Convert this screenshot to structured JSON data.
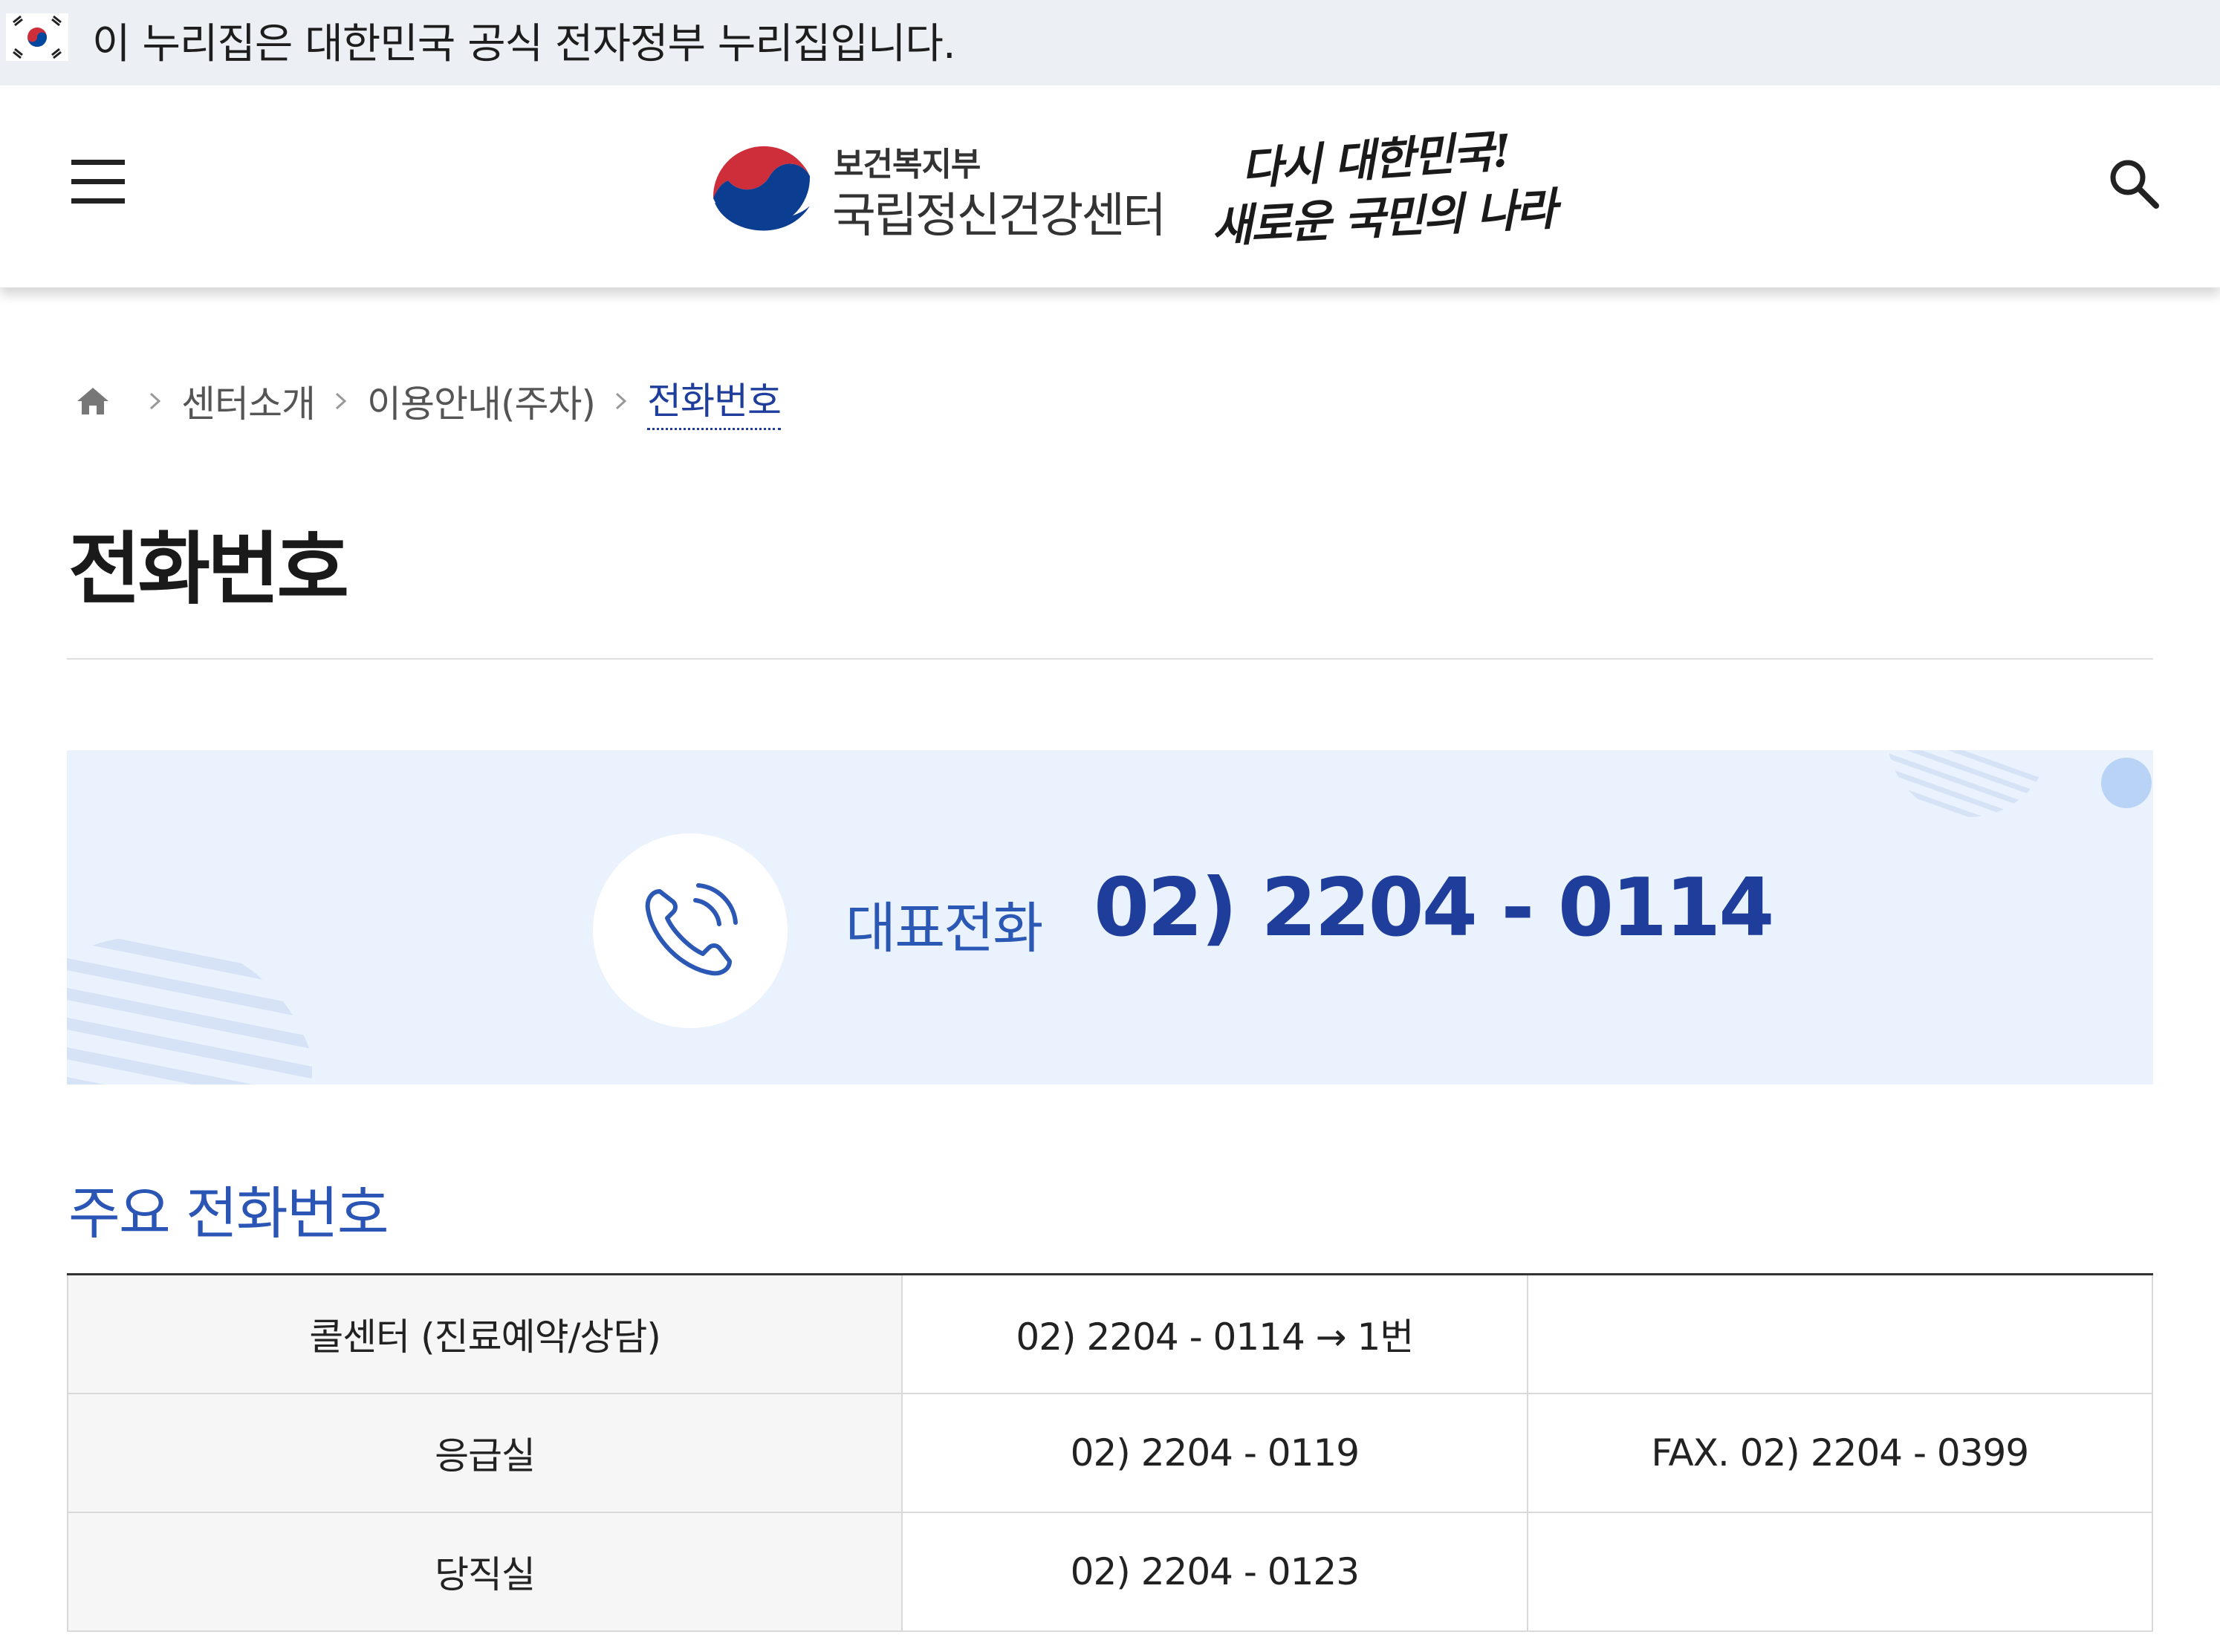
{
  "gov_banner": {
    "text": "이 누리집은 대한민국 공식 전자정부 누리집입니다."
  },
  "header": {
    "ministry": "보건복지부",
    "center_name": "국립정신건강센터",
    "slogan_line1": "다시 대한민국!",
    "slogan_line2": "새로운 국민의 나라"
  },
  "breadcrumb": {
    "items": [
      "센터소개",
      "이용안내(주차)"
    ],
    "current": "전화번호"
  },
  "page_title": "전화번호",
  "main_phone": {
    "label": "대표전화",
    "number": "02) 2204 - 0114"
  },
  "section_title": "주요 전화번호",
  "phone_table": {
    "rows": [
      {
        "name": "콜센터 (진료예약/상담)",
        "phone": "02) 2204 - 0114 → 1번",
        "fax": ""
      },
      {
        "name": "응급실",
        "phone": "02) 2204 - 0119",
        "fax": "FAX. 02) 2204 - 0399"
      },
      {
        "name": "당직실",
        "phone": "02) 2204 - 0123",
        "fax": ""
      }
    ]
  },
  "icons": {
    "menu": "hamburger-menu-icon",
    "search": "search-icon",
    "home": "home-icon",
    "phone": "phone-icon",
    "flag": "korea-flag-icon"
  },
  "colors": {
    "accent_dark": "#1f3e9c",
    "accent": "#2b58b5",
    "panel_bg": "#eaf2fd",
    "banner_bg": "#eceff4"
  }
}
